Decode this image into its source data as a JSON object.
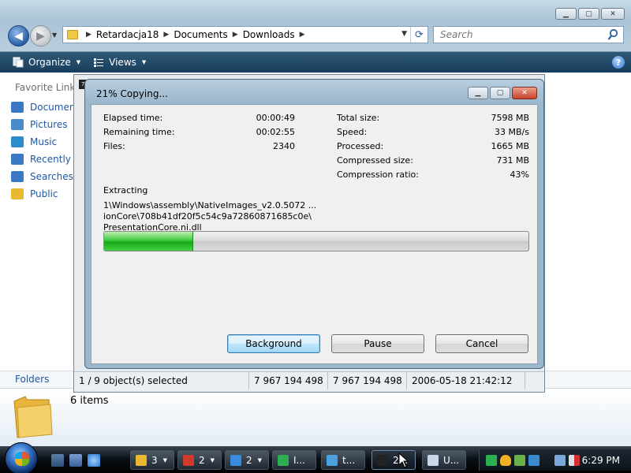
{
  "explorer": {
    "breadcrumb": [
      "Retardacja18",
      "Documents",
      "Downloads"
    ],
    "search": {
      "placeholder": "Search"
    },
    "toolbar": {
      "organize": "Organize",
      "views": "Views"
    },
    "favorites": {
      "title": "Favorite Links",
      "items": [
        {
          "label": "Documents",
          "icon": "documents-icon",
          "color": "#3b78c8"
        },
        {
          "label": "Pictures",
          "icon": "pictures-icon",
          "color": "#4a8ac8"
        },
        {
          "label": "Music",
          "icon": "music-icon",
          "color": "#2d8bd0"
        },
        {
          "label": "Recently Changed",
          "icon": "recent-icon",
          "color": "#3b78c8"
        },
        {
          "label": "Searches",
          "icon": "searches-icon",
          "color": "#3b78c8"
        },
        {
          "label": "Public",
          "icon": "public-folder-icon",
          "color": "#e8b830"
        }
      ]
    },
    "folders_label": "Folders",
    "details": {
      "items_count": "6 items"
    }
  },
  "archive_window": {
    "toolbar_icon": "7z",
    "status": {
      "selected": "1 / 9 object(s) selected",
      "size": "7 967 194 498",
      "packed_size": "7 967 194 498",
      "modified": "2006-05-18 21:42:12"
    }
  },
  "progress_dialog": {
    "title": "21% Copying...",
    "left_stats": [
      {
        "label": "Elapsed time:",
        "value": "00:00:49"
      },
      {
        "label": "Remaining time:",
        "value": "00:02:55"
      },
      {
        "label": "Files:",
        "value": "2340"
      }
    ],
    "right_stats": [
      {
        "label": "Total size:",
        "value": "7598 MB"
      },
      {
        "label": "Speed:",
        "value": "33 MB/s"
      },
      {
        "label": "Processed:",
        "value": "1665 MB"
      },
      {
        "label": "Compressed size:",
        "value": "731 MB"
      },
      {
        "label": "Compression ratio:",
        "value": "43%"
      }
    ],
    "operation": "Extracting",
    "path_line1": "1\\Windows\\assembly\\NativeImages_v2.0.5072 ... ionCore\\708b41df20f5c54c9a72860871685c0e\\",
    "path_line2": "PresentationCore.ni.dll",
    "progress_fraction": 0.21,
    "buttons": {
      "background": "Background",
      "pause": "Pause",
      "cancel": "Cancel"
    }
  },
  "taskbar": {
    "buttons": [
      {
        "label": "3",
        "icon": "folder-group-icon",
        "color": "#e8b830",
        "dropdown": true
      },
      {
        "label": "2",
        "icon": "mail-group-icon",
        "color": "#d03a2a",
        "dropdown": true
      },
      {
        "label": "2",
        "icon": "ie-group-icon",
        "color": "#3a8ae0",
        "dropdown": true
      },
      {
        "label": "I...",
        "icon": "flag-app-icon",
        "color": "#2ab050",
        "dropdown": false
      },
      {
        "label": "t...",
        "icon": "browser-app-icon",
        "color": "#4aa0e0",
        "dropdown": false
      },
      {
        "label": "2...",
        "icon": "7zip-app-icon",
        "color": "#222222",
        "dropdown": false
      },
      {
        "label": "U...",
        "icon": "document-app-icon",
        "color": "#c8d8e8",
        "dropdown": false
      }
    ],
    "clock": "6:29 PM"
  }
}
